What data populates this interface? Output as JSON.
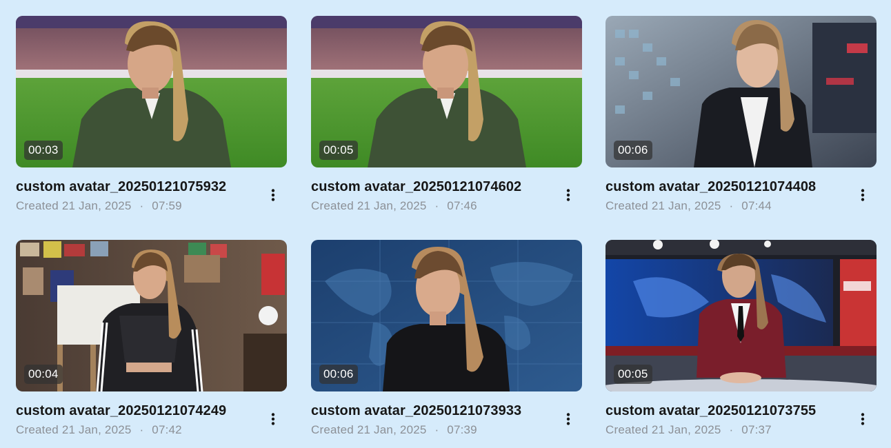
{
  "videos": [
    {
      "title": "custom avatar_20250121075932",
      "created_label": "Created",
      "date": "21 Jan, 2025",
      "time": "07:59",
      "duration": "00:03"
    },
    {
      "title": "custom avatar_20250121074602",
      "created_label": "Created",
      "date": "21 Jan, 2025",
      "time": "07:46",
      "duration": "00:05"
    },
    {
      "title": "custom avatar_20250121074408",
      "created_label": "Created",
      "date": "21 Jan, 2025",
      "time": "07:44",
      "duration": "00:06"
    },
    {
      "title": "custom avatar_20250121074249",
      "created_label": "Created",
      "date": "21 Jan, 2025",
      "time": "07:42",
      "duration": "00:04"
    },
    {
      "title": "custom avatar_20250121073933",
      "created_label": "Created",
      "date": "21 Jan, 2025",
      "time": "07:39",
      "duration": "00:06"
    },
    {
      "title": "custom avatar_20250121073755",
      "created_label": "Created",
      "date": "21 Jan, 2025",
      "time": "07:37",
      "duration": "00:05"
    }
  ],
  "separator": "·",
  "colors": {
    "background": "#d6ebfb",
    "title_text": "#161616",
    "meta_text": "#8c9096",
    "duration_badge": "#323232"
  }
}
